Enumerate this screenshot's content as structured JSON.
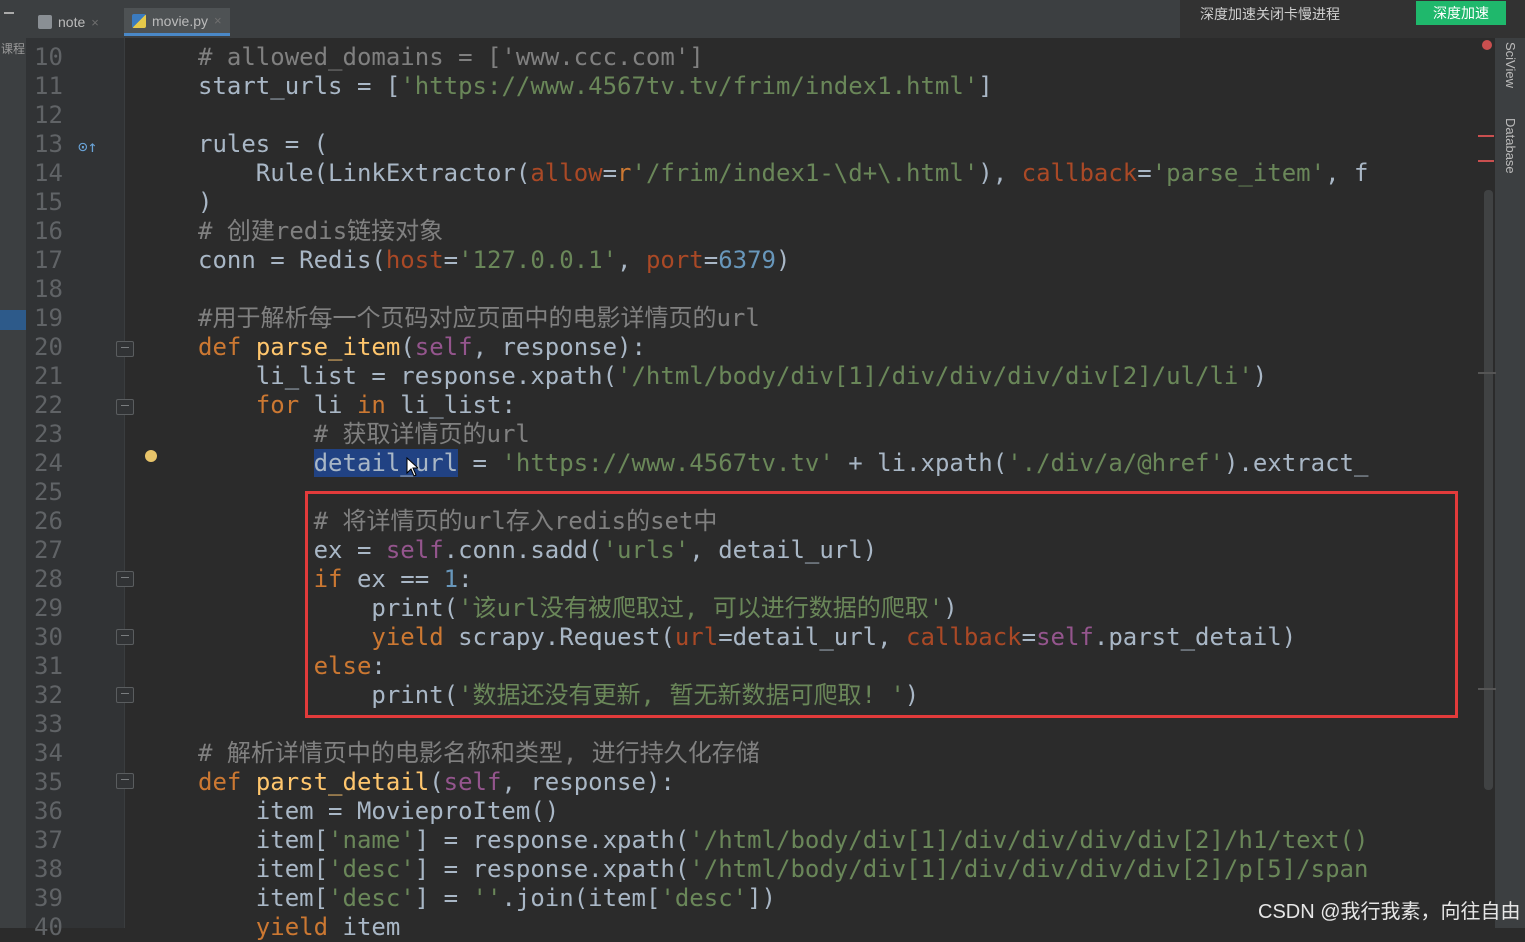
{
  "tabs": [
    {
      "label": "note",
      "close": "×",
      "icon": "document-icon"
    },
    {
      "label": "movie.py",
      "close": "×",
      "icon": "python-file-icon",
      "active": true
    }
  ],
  "left_panel_label": "课程",
  "popup": {
    "message": "深度加速关闭卡慢进程",
    "button": "深度加速"
  },
  "right_tools": [
    "SciView",
    "Database"
  ],
  "watermark": "CSDN @我行我素，向往自由",
  "lines": [
    {
      "n": "10",
      "code": "# allowed_domains = ['www.ccc.com']"
    },
    {
      "n": "11",
      "code": "start_urls = ['https://www.4567tv.tv/frim/index1.html']"
    },
    {
      "n": "12",
      "code": ""
    },
    {
      "n": "13",
      "code": "rules = ("
    },
    {
      "n": "14",
      "code": "    Rule(LinkExtractor(allow=r'/frim/index1-\\d+\\.html'), callback='parse_item', f"
    },
    {
      "n": "15",
      "code": ")"
    },
    {
      "n": "16",
      "code": "# 创建redis链接对象"
    },
    {
      "n": "17",
      "code": "conn = Redis(host='127.0.0.1', port=6379)"
    },
    {
      "n": "18",
      "code": ""
    },
    {
      "n": "19",
      "code": "#用于解析每一个页码对应页面中的电影详情页的url"
    },
    {
      "n": "20",
      "code": "def parse_item(self, response):"
    },
    {
      "n": "21",
      "code": "    li_list = response.xpath('/html/body/div[1]/div/div/div/div[2]/ul/li')"
    },
    {
      "n": "22",
      "code": "    for li in li_list:"
    },
    {
      "n": "23",
      "code": "        # 获取详情页的url"
    },
    {
      "n": "24",
      "code": "        detail_url = 'https://www.4567tv.tv' + li.xpath('./div/a/@href').extract_"
    },
    {
      "n": "25",
      "code": ""
    },
    {
      "n": "26",
      "code": "        # 将详情页的url存入redis的set中"
    },
    {
      "n": "27",
      "code": "        ex = self.conn.sadd('urls', detail_url)"
    },
    {
      "n": "28",
      "code": "        if ex == 1:"
    },
    {
      "n": "29",
      "code": "            print('该url没有被爬取过, 可以进行数据的爬取')"
    },
    {
      "n": "30",
      "code": "            yield scrapy.Request(url=detail_url, callback=self.parst_detail)"
    },
    {
      "n": "31",
      "code": "        else:"
    },
    {
      "n": "32",
      "code": "            print('数据还没有更新, 暂无新数据可爬取! ')"
    },
    {
      "n": "33",
      "code": ""
    },
    {
      "n": "34",
      "code": "# 解析详情页中的电影名称和类型, 进行持久化存储"
    },
    {
      "n": "35",
      "code": "def parst_detail(self, response):"
    },
    {
      "n": "36",
      "code": "    item = MovieproItem()"
    },
    {
      "n": "37",
      "code": "    item['name'] = response.xpath('/html/body/div[1]/div/div/div/div[2]/h1/text()"
    },
    {
      "n": "38",
      "code": "    item['desc'] = response.xpath('/html/body/div[1]/div/div/div/div[2]/p[5]/span"
    },
    {
      "n": "39",
      "code": "    item['desc'] = ''.join(item['desc'])"
    },
    {
      "n": "40",
      "code": "    yield item"
    }
  ]
}
